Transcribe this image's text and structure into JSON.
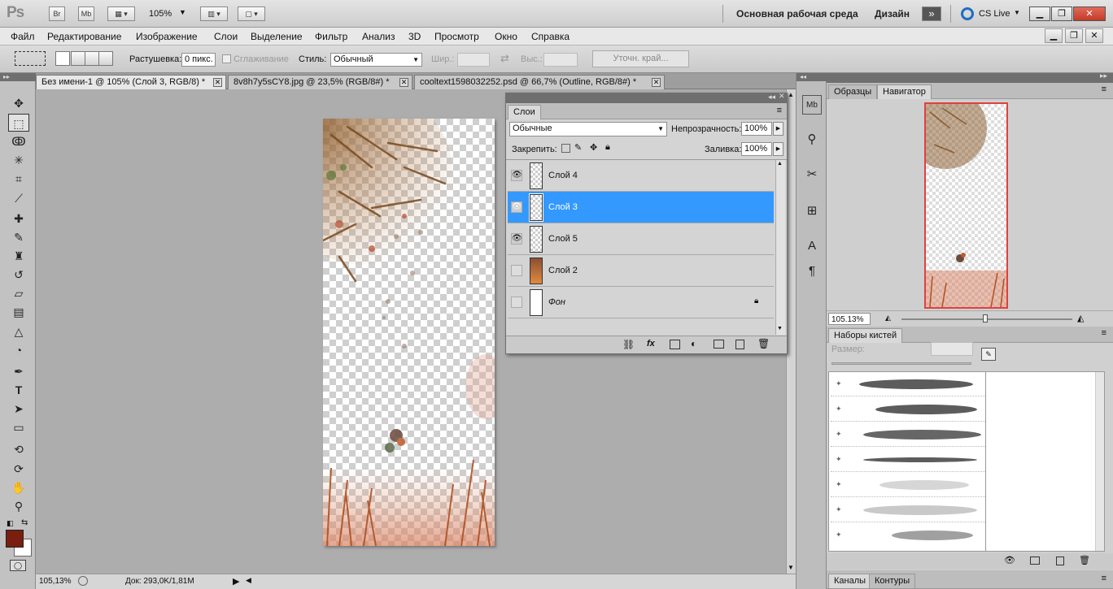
{
  "app": {
    "logo": "Ps",
    "br": "Br",
    "mb": "Mb",
    "zoom": "105%",
    "workspace": "Основная рабочая среда",
    "design": "Дизайн",
    "cslive": "CS Live"
  },
  "menu": [
    "Файл",
    "Редактирование",
    "Изображение",
    "Слои",
    "Выделение",
    "Фильтр",
    "Анализ",
    "3D",
    "Просмотр",
    "Окно",
    "Справка"
  ],
  "options": {
    "feather_label": "Растушевка:",
    "feather_value": "0 пикс.",
    "antialias": "Сглаживание",
    "style_label": "Стиль:",
    "style_value": "Обычный",
    "width_label": "Шир.:",
    "height_label": "Выс.:",
    "refine": "Уточн. край..."
  },
  "tabs": [
    {
      "label": "Без имени-1 @ 105% (Слой 3, RGB/8) *"
    },
    {
      "label": "8v8h7y5sCY8.jpg @ 23,5% (RGB/8#) *"
    },
    {
      "label": "cooltext1598032252.psd @ 66,7% (Outline, RGB/8#) *"
    }
  ],
  "status": {
    "zoom": "105,13%",
    "doc": "Док: 293,0K/1,81M"
  },
  "layers_panel": {
    "tab": "Слои",
    "blend": "Обычные",
    "opacity_label": "Непрозрачность:",
    "opacity_value": "100%",
    "lock_label": "Закрепить:",
    "fill_label": "Заливка:",
    "fill_value": "100%",
    "layers": [
      {
        "name": "Слой 4",
        "visible": true,
        "selected": false
      },
      {
        "name": "Слой 3",
        "visible": true,
        "selected": true
      },
      {
        "name": "Слой 5",
        "visible": true,
        "selected": false
      },
      {
        "name": "Слой 2",
        "visible": false,
        "selected": false
      },
      {
        "name": "Фон",
        "visible": false,
        "selected": false
      }
    ]
  },
  "navigator": {
    "tab_samples": "Образцы",
    "tab_navigator": "Навигатор",
    "zoom": "105.13%"
  },
  "brushes": {
    "title": "Наборы кистей",
    "size_label": "Размер:"
  },
  "bottom_tabs": {
    "channels": "Каналы",
    "paths": "Контуры"
  },
  "colors": {
    "foreground": "#7a1f10",
    "background": "#ffffff",
    "selection": "#3399ff"
  }
}
